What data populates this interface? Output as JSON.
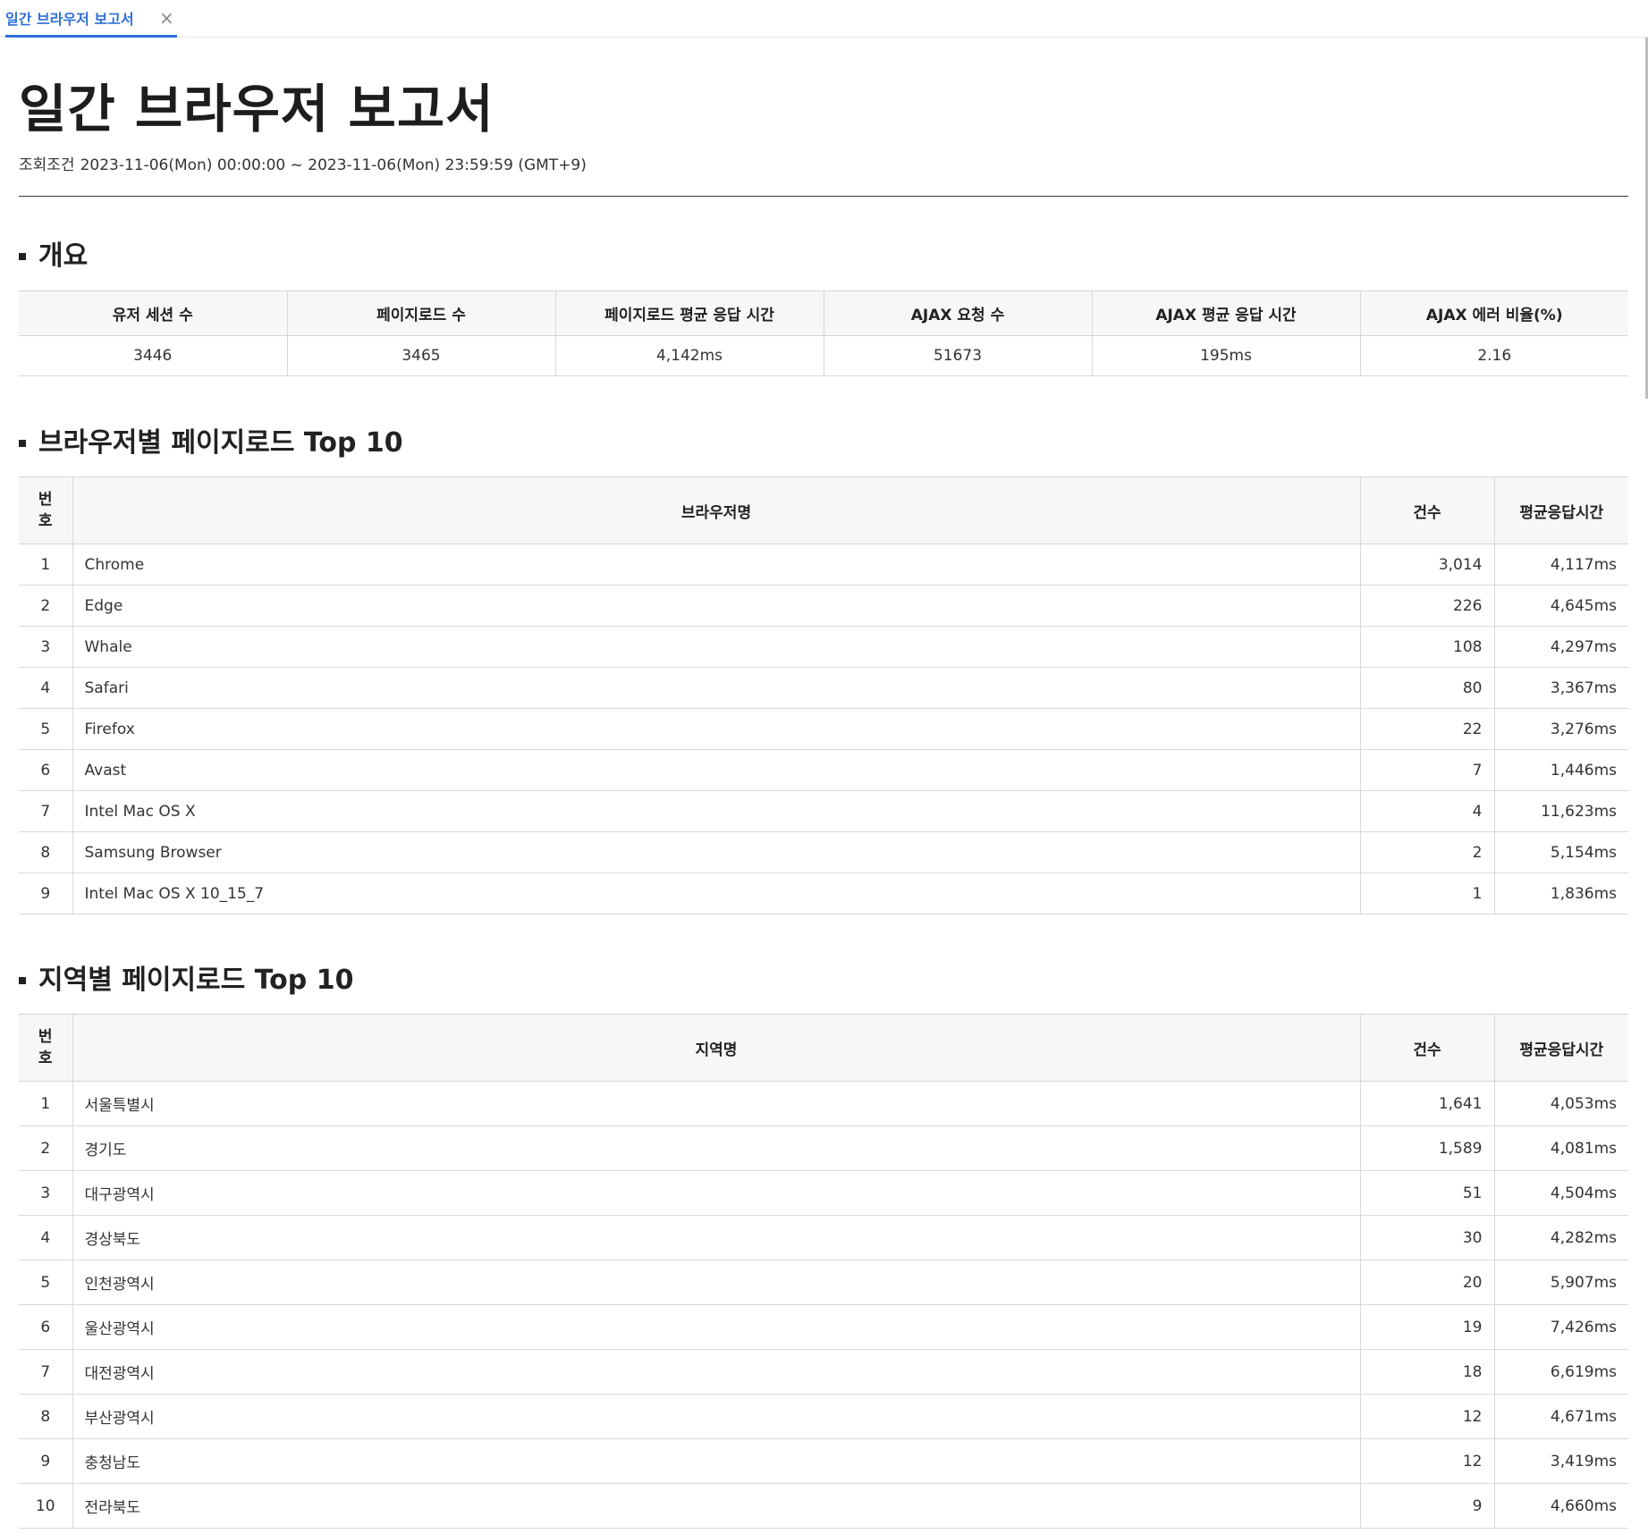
{
  "tab": {
    "label": "일간 브라우저 보고서",
    "close": "×"
  },
  "title": "일간 브라우저 보고서",
  "criteria": {
    "label": "조회조건",
    "value": "2023-11-06(Mon) 00:00:00 ~ 2023-11-06(Mon) 23:59:59 (GMT+9)"
  },
  "overview": {
    "title": "개요",
    "headers": [
      "유저 세션 수",
      "페이지로드 수",
      "페이지로드 평균 응답 시간",
      "AJAX 요청 수",
      "AJAX 평균 응답 시간",
      "AJAX 에러 비율(%)"
    ],
    "values": [
      "3446",
      "3465",
      "4,142ms",
      "51673",
      "195ms",
      "2.16"
    ]
  },
  "browser_top": {
    "title": "브라우저별 페이지로드 Top 10",
    "headers": {
      "num_line1": "번",
      "num_line2": "호",
      "name": "브라우저명",
      "count": "건수",
      "avg": "평균응답시간"
    },
    "rows": [
      {
        "num": "1",
        "name": "Chrome",
        "count": "3,014",
        "avg": "4,117ms"
      },
      {
        "num": "2",
        "name": "Edge",
        "count": "226",
        "avg": "4,645ms"
      },
      {
        "num": "3",
        "name": "Whale",
        "count": "108",
        "avg": "4,297ms"
      },
      {
        "num": "4",
        "name": "Safari",
        "count": "80",
        "avg": "3,367ms"
      },
      {
        "num": "5",
        "name": "Firefox",
        "count": "22",
        "avg": "3,276ms"
      },
      {
        "num": "6",
        "name": "Avast",
        "count": "7",
        "avg": "1,446ms"
      },
      {
        "num": "7",
        "name": "Intel Mac OS X",
        "count": "4",
        "avg": "11,623ms"
      },
      {
        "num": "8",
        "name": "Samsung Browser",
        "count": "2",
        "avg": "5,154ms"
      },
      {
        "num": "9",
        "name": "Intel Mac OS X 10_15_7",
        "count": "1",
        "avg": "1,836ms"
      }
    ]
  },
  "region_top": {
    "title": "지역별 페이지로드 Top 10",
    "headers": {
      "num_line1": "번",
      "num_line2": "호",
      "name": "지역명",
      "count": "건수",
      "avg": "평균응답시간"
    },
    "rows": [
      {
        "num": "1",
        "name": "서울특별시",
        "count": "1,641",
        "avg": "4,053ms"
      },
      {
        "num": "2",
        "name": "경기도",
        "count": "1,589",
        "avg": "4,081ms"
      },
      {
        "num": "3",
        "name": "대구광역시",
        "count": "51",
        "avg": "4,504ms"
      },
      {
        "num": "4",
        "name": "경상북도",
        "count": "30",
        "avg": "4,282ms"
      },
      {
        "num": "5",
        "name": "인천광역시",
        "count": "20",
        "avg": "5,907ms"
      },
      {
        "num": "6",
        "name": "울산광역시",
        "count": "19",
        "avg": "7,426ms"
      },
      {
        "num": "7",
        "name": "대전광역시",
        "count": "18",
        "avg": "6,619ms"
      },
      {
        "num": "8",
        "name": "부산광역시",
        "count": "12",
        "avg": "4,671ms"
      },
      {
        "num": "9",
        "name": "충청남도",
        "count": "12",
        "avg": "3,419ms"
      },
      {
        "num": "10",
        "name": "전라북도",
        "count": "9",
        "avg": "4,660ms"
      }
    ]
  }
}
